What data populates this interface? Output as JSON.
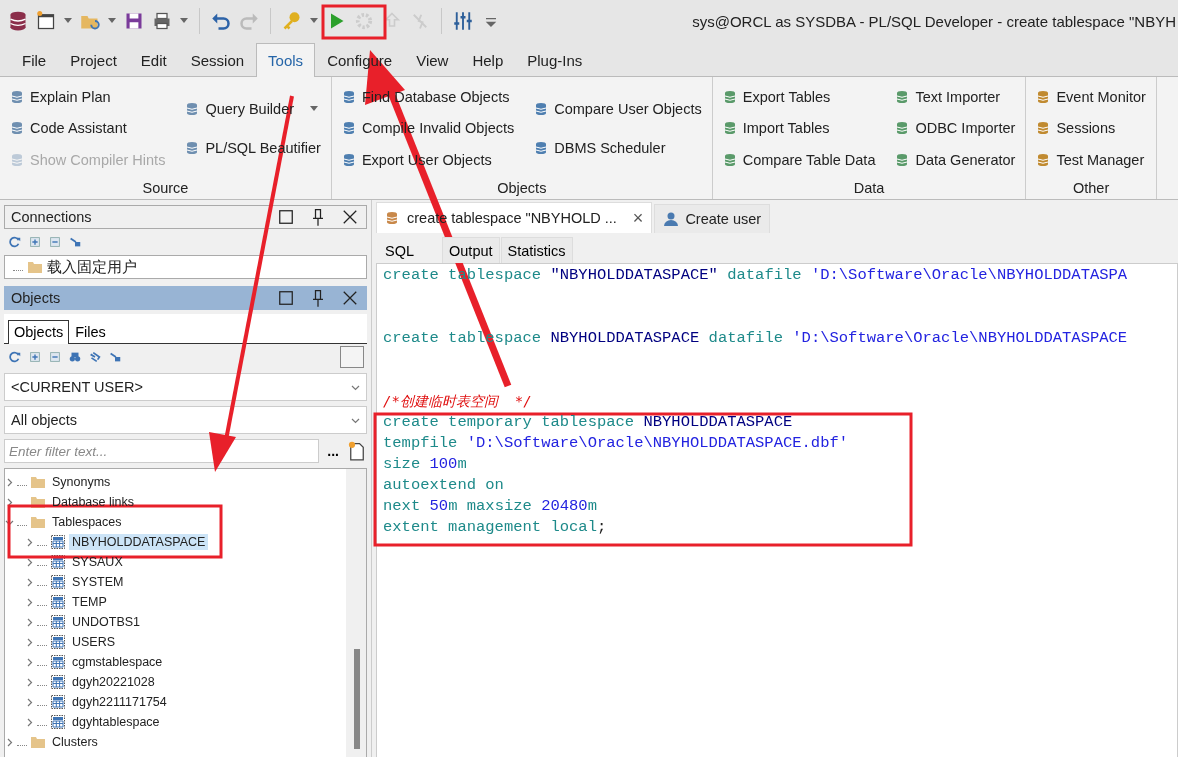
{
  "window": {
    "title": "sys@ORCL as SYSDBA - PL/SQL Developer - create tablespace \"NBYH"
  },
  "menu": [
    {
      "label": "File",
      "selected": false
    },
    {
      "label": "Project",
      "selected": false
    },
    {
      "label": "Edit",
      "selected": false
    },
    {
      "label": "Session",
      "selected": false
    },
    {
      "label": "Tools",
      "selected": true
    },
    {
      "label": "Configure",
      "selected": false
    },
    {
      "label": "View",
      "selected": false
    },
    {
      "label": "Help",
      "selected": false
    },
    {
      "label": "Plug-Ins",
      "selected": false
    }
  ],
  "ribbon": [
    {
      "label": "Source",
      "columns": [
        [
          {
            "label": "Explain Plan",
            "disabled": false
          },
          {
            "label": "Code Assistant",
            "disabled": false
          },
          {
            "label": "Show Compiler Hints",
            "disabled": true
          }
        ],
        [
          {
            "label": "Query Builder",
            "disabled": false,
            "dropdown": true
          },
          {
            "label": "PL/SQL Beautifier",
            "disabled": false
          }
        ]
      ]
    },
    {
      "label": "Objects",
      "columns": [
        [
          {
            "label": "Find Database Objects",
            "disabled": false
          },
          {
            "label": "Compile Invalid Objects",
            "disabled": false
          },
          {
            "label": "Export User Objects",
            "disabled": false
          }
        ],
        [
          {
            "label": "Compare User Objects",
            "disabled": false
          },
          {
            "label": "DBMS Scheduler",
            "disabled": false
          }
        ]
      ]
    },
    {
      "label": "Data",
      "columns": [
        [
          {
            "label": "Export Tables",
            "disabled": false
          },
          {
            "label": "Import Tables",
            "disabled": false
          },
          {
            "label": "Compare Table Data",
            "disabled": false
          }
        ],
        [
          {
            "label": "Text Importer",
            "disabled": false
          },
          {
            "label": "ODBC Importer",
            "disabled": false
          },
          {
            "label": "Data Generator",
            "disabled": false
          }
        ]
      ]
    },
    {
      "label": "Other",
      "columns": [
        [
          {
            "label": "Event Monitor",
            "disabled": false
          },
          {
            "label": "Sessions",
            "disabled": false
          },
          {
            "label": "Test Manager",
            "disabled": false
          }
        ]
      ]
    }
  ],
  "connections": {
    "title": "Connections",
    "items": [
      "载入固定用户"
    ]
  },
  "objects": {
    "title": "Objects",
    "tabs": [
      {
        "label": "Objects",
        "selected": true
      },
      {
        "label": "Files",
        "selected": false
      }
    ],
    "user_select": "<CURRENT USER>",
    "type_select": "All objects",
    "filter": {
      "placeholder": "Enter filter text...",
      "more": "..."
    },
    "tree": [
      {
        "label": "Synonyms",
        "kind": "folder",
        "expanded": false,
        "selected": false
      },
      {
        "label": "Database links",
        "kind": "folder",
        "expanded": false,
        "selected": false
      },
      {
        "label": "Tablespaces",
        "kind": "folder",
        "expanded": true,
        "selected": false,
        "children": [
          {
            "label": "NBYHOLDDATASPACE",
            "kind": "tablespace",
            "expanded": false,
            "selected": true
          },
          {
            "label": "SYSAUX",
            "kind": "tablespace",
            "expanded": false,
            "selected": false
          },
          {
            "label": "SYSTEM",
            "kind": "tablespace",
            "expanded": false,
            "selected": false
          },
          {
            "label": "TEMP",
            "kind": "tablespace",
            "expanded": false,
            "selected": false
          },
          {
            "label": "UNDOTBS1",
            "kind": "tablespace",
            "expanded": false,
            "selected": false
          },
          {
            "label": "USERS",
            "kind": "tablespace",
            "expanded": false,
            "selected": false
          },
          {
            "label": "cgmstablespace",
            "kind": "tablespace",
            "expanded": false,
            "selected": false
          },
          {
            "label": "dgyh20221028",
            "kind": "tablespace",
            "expanded": false,
            "selected": false
          },
          {
            "label": "dgyh2211171754",
            "kind": "tablespace",
            "expanded": false,
            "selected": false
          },
          {
            "label": "dgyhtablespace",
            "kind": "tablespace",
            "expanded": false,
            "selected": false
          }
        ]
      },
      {
        "label": "Clusters",
        "kind": "folder",
        "expanded": false,
        "selected": false
      }
    ]
  },
  "documents": [
    {
      "label": "create tablespace \"NBYHOLD ...",
      "kind": "sql",
      "selected": true,
      "close": "×"
    },
    {
      "label": "Create user",
      "kind": "user",
      "selected": false
    }
  ],
  "editor_tabs": [
    {
      "label": "SQL",
      "selected": true
    },
    {
      "label": "Output",
      "selected": false
    },
    {
      "label": "Statistics",
      "selected": false
    }
  ],
  "code": [
    {
      "kind": "code",
      "tokens": [
        {
          "kind": "keyword",
          "text": "create tablespace "
        },
        {
          "kind": "ident",
          "text": "\"NBYHOLDDATASPACE\" "
        },
        {
          "kind": "keyword",
          "text": "datafile "
        },
        {
          "kind": "string",
          "text": "'D:\\Software\\Oracle\\NBYHOLDDATASPA"
        }
      ]
    },
    {
      "kind": "blank"
    },
    {
      "kind": "blank"
    },
    {
      "kind": "code",
      "tokens": [
        {
          "kind": "keyword",
          "text": "create tablespace "
        },
        {
          "kind": "ident",
          "text": "NBYHOLDDATASPACE "
        },
        {
          "kind": "keyword",
          "text": "datafile "
        },
        {
          "kind": "string",
          "text": "'D:\\Software\\Oracle\\NBYHOLDDATASPACE"
        }
      ]
    },
    {
      "kind": "blank"
    },
    {
      "kind": "blank"
    },
    {
      "kind": "code",
      "tokens": [
        {
          "kind": "comment",
          "text": "/*创建临时表空间  */"
        }
      ]
    },
    {
      "kind": "code",
      "tokens": [
        {
          "kind": "keyword",
          "text": "create temporary tablespace "
        },
        {
          "kind": "ident",
          "text": "NBYHOLDDATASPACE"
        }
      ]
    },
    {
      "kind": "code",
      "tokens": [
        {
          "kind": "keyword",
          "text": "tempfile "
        },
        {
          "kind": "string",
          "text": "'D:\\Software\\Oracle\\NBYHOLDDATASPACE.dbf'"
        }
      ]
    },
    {
      "kind": "code",
      "tokens": [
        {
          "kind": "keyword",
          "text": "size "
        },
        {
          "kind": "number",
          "text": "100"
        },
        {
          "kind": "keyword",
          "text": "m"
        }
      ]
    },
    {
      "kind": "code",
      "tokens": [
        {
          "kind": "keyword",
          "text": "autoextend on"
        }
      ]
    },
    {
      "kind": "code",
      "tokens": [
        {
          "kind": "keyword",
          "text": "next "
        },
        {
          "kind": "number",
          "text": "50"
        },
        {
          "kind": "keyword",
          "text": "m maxsize "
        },
        {
          "kind": "number",
          "text": "20480"
        },
        {
          "kind": "keyword",
          "text": "m"
        }
      ]
    },
    {
      "kind": "code",
      "tokens": [
        {
          "kind": "keyword",
          "text": "extent management local"
        },
        {
          "kind": "plain",
          "text": ";"
        }
      ]
    }
  ]
}
